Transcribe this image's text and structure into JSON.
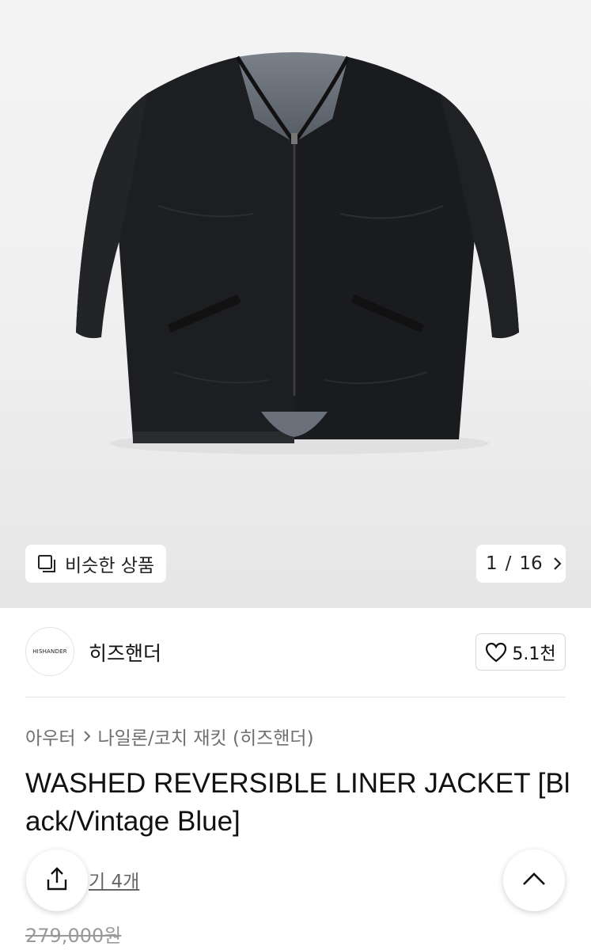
{
  "hero": {
    "image_alt": "Black reversible liner jacket",
    "similar_label": "비슷한 상품",
    "page_current": "1",
    "page_total": "16"
  },
  "brand": {
    "logo_text": "HISHANDER",
    "name": "히즈핸더",
    "likes": "5.1천"
  },
  "breadcrumb": {
    "category": "아우터",
    "subcategory": "나일론/코치 재킷 (히즈핸더)"
  },
  "product": {
    "title": "WASHED REVERSIBLE LINER JACKET [Black/Vintage Blue]",
    "review_text": "기 4개",
    "price": "279,000원"
  },
  "icons": {
    "similar": "stacked-squares-icon",
    "next": "chevron-right-icon",
    "like": "heart-outline-icon",
    "share": "share-icon",
    "scroll_top": "chevron-up-icon"
  },
  "colors": {
    "jacket": "#1b1c1e",
    "lining": "#6b7078"
  }
}
